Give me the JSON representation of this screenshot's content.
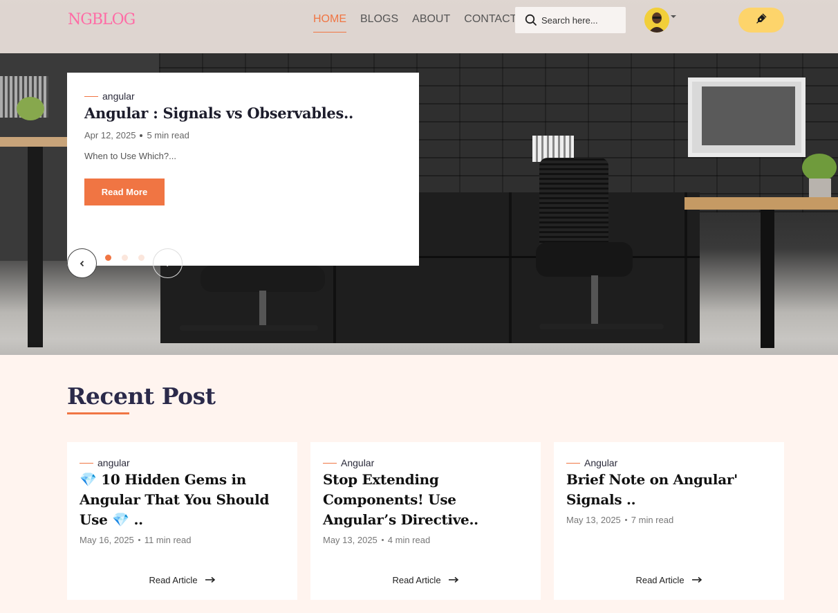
{
  "header": {
    "logo": "NGBLOG",
    "nav": [
      {
        "label": "HOME",
        "active": true
      },
      {
        "label": "BLOGS",
        "active": false
      },
      {
        "label": "ABOUT",
        "active": false
      },
      {
        "label": "CONTACT",
        "active": false
      }
    ],
    "search": {
      "placeholder": "Search here...",
      "value": "",
      "icon": "search-icon"
    },
    "avatar_icon": "avatar",
    "write_icon": "pen-nib-icon"
  },
  "hero": {
    "category": "angular",
    "title": "Angular : Signals vs Observables..",
    "date": "Apr 12, 2025",
    "read_time": "5 min read",
    "excerpt": "When to Use Which?...",
    "button_label": "Read More",
    "slides": 3,
    "active_slide": 1
  },
  "recent": {
    "title": "Recent Post",
    "read_label": "Read Article",
    "posts": [
      {
        "category": "angular",
        "title": "💎 10 Hidden Gems in Angular That You Should Use 💎 ..",
        "date": "May 16, 2025",
        "read_time": "11 min read"
      },
      {
        "category": "Angular",
        "title": "Stop Extending Components! Use Angular’s Directive..",
        "date": "May 13, 2025",
        "read_time": "4 min read"
      },
      {
        "category": "Angular",
        "title": "Brief Note on Angular' Signals ..",
        "date": "May 13, 2025",
        "read_time": "7 min read"
      }
    ]
  },
  "colors": {
    "accent": "#f07543",
    "logo": "#ff6ba5",
    "write_button": "#fdd46b",
    "page_bg": "#fff4ef",
    "heading": "#2b2a4a"
  }
}
